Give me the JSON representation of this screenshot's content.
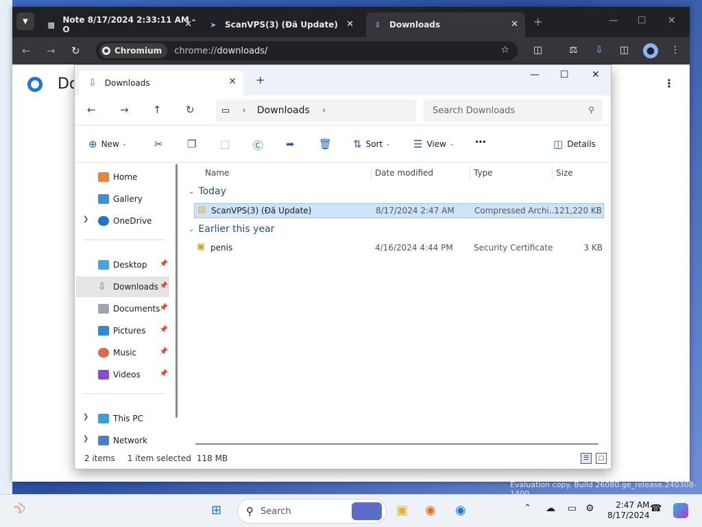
{
  "browser": {
    "tabs": [
      {
        "title": "Note 8/17/2024 2:33:11 AM - O",
        "icon": "document-icon"
      },
      {
        "title": "ScanVPS(3) (Đã Update)",
        "icon": "bird-icon"
      },
      {
        "title": "Downloads",
        "icon": "download-icon"
      }
    ],
    "site_chip": "Chromium",
    "url_scheme": "chrome://",
    "url_path": "downloads/",
    "page_title": "Do"
  },
  "explorer": {
    "tab_title": "Downloads",
    "breadcrumb": "Downloads",
    "search_placeholder": "Search Downloads",
    "commands": {
      "new": "New",
      "sort": "Sort",
      "view": "View",
      "details": "Details"
    },
    "nav": {
      "home": "Home",
      "gallery": "Gallery",
      "onedrive": "OneDrive",
      "desktop": "Desktop",
      "downloads": "Downloads",
      "documents": "Documents",
      "pictures": "Pictures",
      "music": "Music",
      "videos": "Videos",
      "thispc": "This PC",
      "network": "Network"
    },
    "columns": {
      "name": "Name",
      "date": "Date modified",
      "type": "Type",
      "size": "Size"
    },
    "groups": [
      {
        "label": "Today",
        "files": [
          {
            "name": "ScanVPS(3) (Đã Update)",
            "date": "8/17/2024 2:47 AM",
            "type": "Compressed Archi...",
            "size": "121,220 KB"
          }
        ]
      },
      {
        "label": "Earlier this year",
        "files": [
          {
            "name": "penis",
            "date": "4/16/2024 4:44 PM",
            "type": "Security Certificate",
            "size": "3 KB"
          }
        ]
      }
    ],
    "status": {
      "items": "2 items",
      "selected": "1 item selected",
      "size": "118 MB"
    }
  },
  "watermark": "Evaluation copy. Build 26080.ge_release.240308-1400",
  "taskbar": {
    "search": "Search",
    "time": "2:47 AM",
    "date": "8/17/2024"
  }
}
